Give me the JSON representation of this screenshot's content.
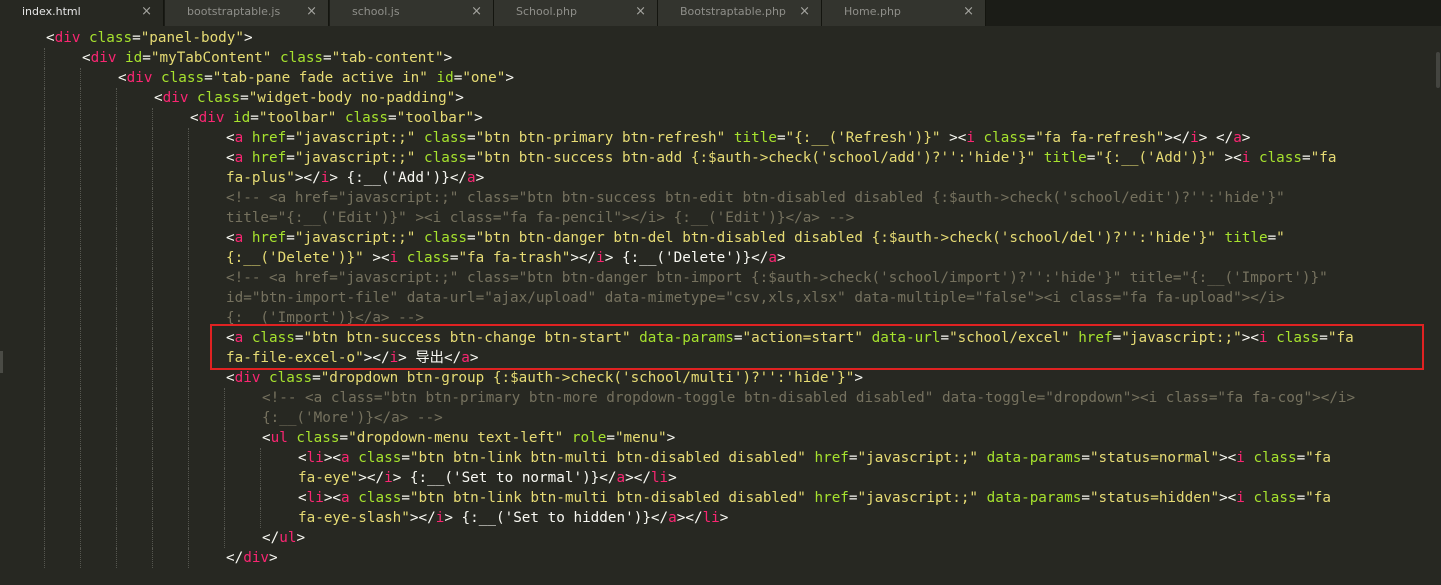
{
  "tabs": [
    {
      "label": "index.html",
      "active": true
    },
    {
      "label": "bootstraptable.js",
      "active": false
    },
    {
      "label": "school.js",
      "active": false
    },
    {
      "label": "School.php",
      "active": false
    },
    {
      "label": "Bootstraptable.php",
      "active": false
    },
    {
      "label": "Home.php",
      "active": false
    }
  ],
  "close_glyph": "×",
  "colors": {
    "background": "#272822",
    "tag": "#f92672",
    "attribute": "#a6e22e",
    "string": "#e6db74",
    "comment": "#75715e",
    "highlight_box": "#e02222"
  },
  "code_lines": [
    {
      "indent": 1,
      "segments": [
        [
          "p",
          "<"
        ],
        [
          "t",
          "div"
        ],
        [
          "a",
          " class"
        ],
        [
          "p",
          "="
        ],
        [
          "s",
          "\"panel-body\""
        ],
        [
          "p",
          ">"
        ]
      ]
    },
    {
      "indent": 2,
      "segments": [
        [
          "p",
          "<"
        ],
        [
          "t",
          "div"
        ],
        [
          "a",
          " id"
        ],
        [
          "p",
          "="
        ],
        [
          "s",
          "\"myTabContent\""
        ],
        [
          "a",
          " class"
        ],
        [
          "p",
          "="
        ],
        [
          "s",
          "\"tab-content\""
        ],
        [
          "p",
          ">"
        ]
      ]
    },
    {
      "indent": 3,
      "segments": [
        [
          "p",
          "<"
        ],
        [
          "t",
          "div"
        ],
        [
          "a",
          " class"
        ],
        [
          "p",
          "="
        ],
        [
          "s",
          "\"tab-pane fade active in\""
        ],
        [
          "a",
          " id"
        ],
        [
          "p",
          "="
        ],
        [
          "s",
          "\"one\""
        ],
        [
          "p",
          ">"
        ]
      ]
    },
    {
      "indent": 4,
      "segments": [
        [
          "p",
          "<"
        ],
        [
          "t",
          "div"
        ],
        [
          "a",
          " class"
        ],
        [
          "p",
          "="
        ],
        [
          "s",
          "\"widget-body no-padding\""
        ],
        [
          "p",
          ">"
        ]
      ]
    },
    {
      "indent": 5,
      "segments": [
        [
          "p",
          "<"
        ],
        [
          "t",
          "div"
        ],
        [
          "a",
          " id"
        ],
        [
          "p",
          "="
        ],
        [
          "s",
          "\"toolbar\""
        ],
        [
          "a",
          " class"
        ],
        [
          "p",
          "="
        ],
        [
          "s",
          "\"toolbar\""
        ],
        [
          "p",
          ">"
        ]
      ]
    },
    {
      "indent": 6,
      "segments": [
        [
          "p",
          "<"
        ],
        [
          "t",
          "a"
        ],
        [
          "a",
          " href"
        ],
        [
          "p",
          "="
        ],
        [
          "s",
          "\"javascript:;\""
        ],
        [
          "a",
          " class"
        ],
        [
          "p",
          "="
        ],
        [
          "s",
          "\"btn btn-primary btn-refresh\""
        ],
        [
          "a",
          " title"
        ],
        [
          "p",
          "="
        ],
        [
          "s",
          "\"{:__('Refresh')}\""
        ],
        [
          "p",
          " ><"
        ],
        [
          "t",
          "i"
        ],
        [
          "a",
          " class"
        ],
        [
          "p",
          "="
        ],
        [
          "s",
          "\"fa fa-refresh\""
        ],
        [
          "p",
          "></"
        ],
        [
          "t",
          "i"
        ],
        [
          "p",
          "> </"
        ],
        [
          "t",
          "a"
        ],
        [
          "p",
          ">"
        ]
      ]
    },
    {
      "indent": 6,
      "segments": [
        [
          "p",
          "<"
        ],
        [
          "t",
          "a"
        ],
        [
          "a",
          " href"
        ],
        [
          "p",
          "="
        ],
        [
          "s",
          "\"javascript:;\""
        ],
        [
          "a",
          " class"
        ],
        [
          "p",
          "="
        ],
        [
          "s",
          "\"btn btn-success btn-add {:$auth->check('school/add')?'':'hide'}\""
        ],
        [
          "a",
          " title"
        ],
        [
          "p",
          "="
        ],
        [
          "s",
          "\"{:__('Add')}\""
        ],
        [
          "p",
          " ><"
        ],
        [
          "t",
          "i"
        ],
        [
          "a",
          " class"
        ],
        [
          "p",
          "="
        ],
        [
          "s",
          "\"fa"
        ]
      ]
    },
    {
      "indent": 6,
      "segments": [
        [
          "s",
          "fa-plus\""
        ],
        [
          "p",
          "></"
        ],
        [
          "t",
          "i"
        ],
        [
          "p",
          "> {:__('Add')}</"
        ],
        [
          "t",
          "a"
        ],
        [
          "p",
          ">"
        ]
      ]
    },
    {
      "indent": 6,
      "segments": [
        [
          "c",
          "<!-- <a href=\"javascript:;\" class=\"btn btn-success btn-edit btn-disabled disabled {:$auth->check('school/edit')?'':'hide'}\""
        ]
      ]
    },
    {
      "indent": 6,
      "segments": [
        [
          "c",
          "title=\"{:__('Edit')}\" ><i class=\"fa fa-pencil\"></i> {:__('Edit')}</a> -->"
        ]
      ]
    },
    {
      "indent": 6,
      "segments": [
        [
          "p",
          "<"
        ],
        [
          "t",
          "a"
        ],
        [
          "a",
          " href"
        ],
        [
          "p",
          "="
        ],
        [
          "s",
          "\"javascript:;\""
        ],
        [
          "a",
          " class"
        ],
        [
          "p",
          "="
        ],
        [
          "s",
          "\"btn btn-danger btn-del btn-disabled disabled {:$auth->check('school/del')?'':'hide'}\""
        ],
        [
          "a",
          " title"
        ],
        [
          "p",
          "="
        ],
        [
          "s",
          "\""
        ]
      ]
    },
    {
      "indent": 6,
      "segments": [
        [
          "s",
          "{:__('Delete')}\""
        ],
        [
          "p",
          " ><"
        ],
        [
          "t",
          "i"
        ],
        [
          "a",
          " class"
        ],
        [
          "p",
          "="
        ],
        [
          "s",
          "\"fa fa-trash\""
        ],
        [
          "p",
          "></"
        ],
        [
          "t",
          "i"
        ],
        [
          "p",
          "> {:__('Delete')}</"
        ],
        [
          "t",
          "a"
        ],
        [
          "p",
          ">"
        ]
      ]
    },
    {
      "indent": 6,
      "segments": [
        [
          "c",
          "<!-- <a href=\"javascript:;\" class=\"btn btn-danger btn-import {:$auth->check('school/import')?'':'hide'}\" title=\"{:__('Import')}\""
        ]
      ]
    },
    {
      "indent": 6,
      "segments": [
        [
          "c",
          "id=\"btn-import-file\" data-url=\"ajax/upload\" data-mimetype=\"csv,xls,xlsx\" data-multiple=\"false\"><i class=\"fa fa-upload\"></i>"
        ]
      ]
    },
    {
      "indent": 6,
      "segments": [
        [
          "c",
          "{:__('Import')}</a> -->"
        ]
      ]
    },
    {
      "indent": 6,
      "segments": [
        [
          "p",
          "<"
        ],
        [
          "t",
          "a"
        ],
        [
          "a",
          " class"
        ],
        [
          "p",
          "="
        ],
        [
          "s",
          "\"btn btn-success btn-change btn-start\""
        ],
        [
          "a",
          " data-params"
        ],
        [
          "p",
          "="
        ],
        [
          "s",
          "\"action=start\""
        ],
        [
          "a",
          " data-url"
        ],
        [
          "p",
          "="
        ],
        [
          "s",
          "\"school/excel\""
        ],
        [
          "a",
          " href"
        ],
        [
          "p",
          "="
        ],
        [
          "s",
          "\"javascript:;\""
        ],
        [
          "p",
          "><"
        ],
        [
          "t",
          "i"
        ],
        [
          "a",
          " class"
        ],
        [
          "p",
          "="
        ],
        [
          "s",
          "\"fa"
        ]
      ]
    },
    {
      "indent": 6,
      "segments": [
        [
          "s",
          "fa-file-excel-o\""
        ],
        [
          "p",
          "></"
        ],
        [
          "t",
          "i"
        ],
        [
          "p",
          "> 导出</"
        ],
        [
          "t",
          "a"
        ],
        [
          "p",
          ">"
        ]
      ]
    },
    {
      "indent": 6,
      "segments": [
        [
          "p",
          "<"
        ],
        [
          "t",
          "div"
        ],
        [
          "a",
          " class"
        ],
        [
          "p",
          "="
        ],
        [
          "s",
          "\"dropdown btn-group {:$auth->check('school/multi')?'':'hide'}\""
        ],
        [
          "p",
          ">"
        ]
      ]
    },
    {
      "indent": 7,
      "segments": [
        [
          "c",
          "<!-- <a class=\"btn btn-primary btn-more dropdown-toggle btn-disabled disabled\" data-toggle=\"dropdown\"><i class=\"fa fa-cog\"></i>"
        ]
      ]
    },
    {
      "indent": 7,
      "segments": [
        [
          "c",
          "{:__('More')}</a> -->"
        ]
      ]
    },
    {
      "indent": 7,
      "segments": [
        [
          "p",
          "<"
        ],
        [
          "t",
          "ul"
        ],
        [
          "a",
          " class"
        ],
        [
          "p",
          "="
        ],
        [
          "s",
          "\"dropdown-menu text-left\""
        ],
        [
          "a",
          " role"
        ],
        [
          "p",
          "="
        ],
        [
          "s",
          "\"menu\""
        ],
        [
          "p",
          ">"
        ]
      ]
    },
    {
      "indent": 8,
      "segments": [
        [
          "p",
          "<"
        ],
        [
          "t",
          "li"
        ],
        [
          "p",
          "><"
        ],
        [
          "t",
          "a"
        ],
        [
          "a",
          " class"
        ],
        [
          "p",
          "="
        ],
        [
          "s",
          "\"btn btn-link btn-multi btn-disabled disabled\""
        ],
        [
          "a",
          " href"
        ],
        [
          "p",
          "="
        ],
        [
          "s",
          "\"javascript:;\""
        ],
        [
          "a",
          " data-params"
        ],
        [
          "p",
          "="
        ],
        [
          "s",
          "\"status=normal\""
        ],
        [
          "p",
          "><"
        ],
        [
          "t",
          "i"
        ],
        [
          "a",
          " class"
        ],
        [
          "p",
          "="
        ],
        [
          "s",
          "\"fa"
        ]
      ]
    },
    {
      "indent": 8,
      "segments": [
        [
          "s",
          "fa-eye\""
        ],
        [
          "p",
          "></"
        ],
        [
          "t",
          "i"
        ],
        [
          "p",
          "> {:__('Set to normal')}</"
        ],
        [
          "t",
          "a"
        ],
        [
          "p",
          "></"
        ],
        [
          "t",
          "li"
        ],
        [
          "p",
          ">"
        ]
      ]
    },
    {
      "indent": 8,
      "segments": [
        [
          "p",
          "<"
        ],
        [
          "t",
          "li"
        ],
        [
          "p",
          "><"
        ],
        [
          "t",
          "a"
        ],
        [
          "a",
          " class"
        ],
        [
          "p",
          "="
        ],
        [
          "s",
          "\"btn btn-link btn-multi btn-disabled disabled\""
        ],
        [
          "a",
          " href"
        ],
        [
          "p",
          "="
        ],
        [
          "s",
          "\"javascript:;\""
        ],
        [
          "a",
          " data-params"
        ],
        [
          "p",
          "="
        ],
        [
          "s",
          "\"status=hidden\""
        ],
        [
          "p",
          "><"
        ],
        [
          "t",
          "i"
        ],
        [
          "a",
          " class"
        ],
        [
          "p",
          "="
        ],
        [
          "s",
          "\"fa"
        ]
      ]
    },
    {
      "indent": 8,
      "segments": [
        [
          "s",
          "fa-eye-slash\""
        ],
        [
          "p",
          "></"
        ],
        [
          "t",
          "i"
        ],
        [
          "p",
          "> {:__('Set to hidden')}</"
        ],
        [
          "t",
          "a"
        ],
        [
          "p",
          "></"
        ],
        [
          "t",
          "li"
        ],
        [
          "p",
          ">"
        ]
      ]
    },
    {
      "indent": 7,
      "segments": [
        [
          "p",
          "</"
        ],
        [
          "t",
          "ul"
        ],
        [
          "p",
          ">"
        ]
      ]
    },
    {
      "indent": 6,
      "segments": [
        [
          "p",
          "</"
        ],
        [
          "t",
          "div"
        ],
        [
          "p",
          ">"
        ]
      ]
    }
  ]
}
